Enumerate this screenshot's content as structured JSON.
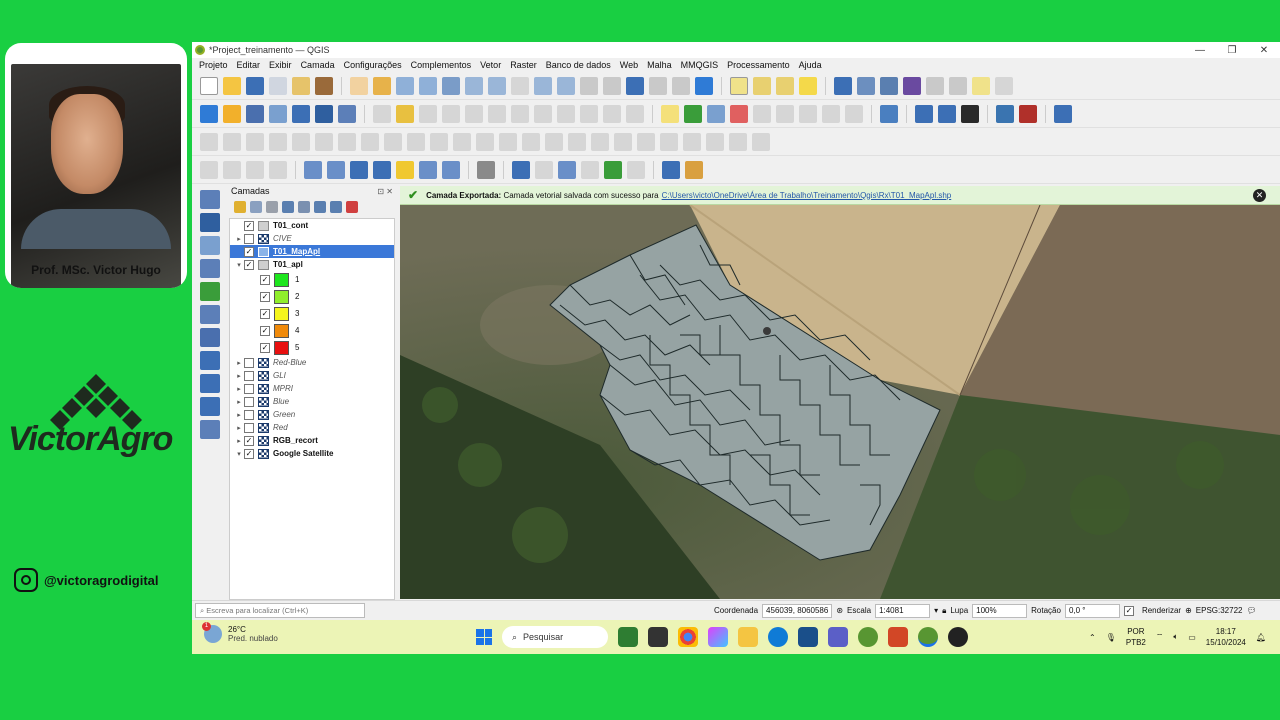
{
  "presenter": {
    "name": "Prof. MSc. Victor Hugo"
  },
  "brand": {
    "name": "VictorAgro",
    "instagram": "@victoragrodigital",
    "accent": "#19cf42"
  },
  "window": {
    "title": "*Project_treinamento — QGIS",
    "controls": {
      "minimize": "—",
      "maximize": "❐",
      "close": "✕"
    }
  },
  "menu": [
    "Projeto",
    "Editar",
    "Exibir",
    "Camada",
    "Configurações",
    "Complementos",
    "Vetor",
    "Raster",
    "Banco de dados",
    "Web",
    "Malha",
    "MMQGIS",
    "Processamento",
    "Ajuda"
  ],
  "layers_panel": {
    "title": "Camadas",
    "controls": "⊡ ✕",
    "layers": [
      {
        "name": "T01_cont",
        "checked": true,
        "expand": "",
        "style": "bold",
        "icon": "poly"
      },
      {
        "name": "CIVE",
        "checked": false,
        "expand": "▸",
        "style": "it",
        "icon": "raster"
      },
      {
        "name": "T01_MapApl",
        "checked": true,
        "expand": "",
        "style": "bold",
        "icon": "polysel",
        "selected": true
      },
      {
        "name": "T01_apl",
        "checked": true,
        "expand": "▾",
        "style": "bold",
        "icon": "poly"
      },
      {
        "name": "1",
        "checked": true,
        "class_color": "#1ee61e"
      },
      {
        "name": "2",
        "checked": true,
        "class_color": "#90ee2c"
      },
      {
        "name": "3",
        "checked": true,
        "class_color": "#f5f51c"
      },
      {
        "name": "4",
        "checked": true,
        "class_color": "#f08a0a"
      },
      {
        "name": "5",
        "checked": true,
        "class_color": "#e81010"
      },
      {
        "name": "Red-Blue",
        "checked": false,
        "expand": "▸",
        "style": "it",
        "icon": "raster"
      },
      {
        "name": "GLI",
        "checked": false,
        "expand": "▸",
        "style": "it",
        "icon": "raster"
      },
      {
        "name": "MPRI",
        "checked": false,
        "expand": "▸",
        "style": "it",
        "icon": "raster"
      },
      {
        "name": "Blue",
        "checked": false,
        "expand": "▸",
        "style": "it",
        "icon": "raster"
      },
      {
        "name": "Green",
        "checked": false,
        "expand": "▸",
        "style": "it",
        "icon": "raster"
      },
      {
        "name": "Red",
        "checked": false,
        "expand": "▸",
        "style": "it",
        "icon": "raster"
      },
      {
        "name": "RGB_recort",
        "checked": true,
        "expand": "▸",
        "style": "bold",
        "icon": "raster"
      },
      {
        "name": "Google Satellite",
        "checked": true,
        "expand": "▾",
        "style": "bold",
        "icon": "raster"
      }
    ]
  },
  "message_bar": {
    "title": "Camada Exportada:",
    "text": "Camada vetorial salvada com sucesso para",
    "path": "C:\\Users\\victo\\OneDrive\\Área de Trabalho\\Treinamento\\Qgis\\Rx\\T01_MapApl.shp"
  },
  "statusbar": {
    "locator_placeholder": "Escreva para localizar (Ctrl+K)",
    "coord_label": "Coordenada",
    "coord_value": "456039, 8060586",
    "scale_label": "Escala",
    "scale_value": "1:4081",
    "magnifier_label": "Lupa",
    "magnifier_value": "100%",
    "rotation_label": "Rotação",
    "rotation_value": "0,0 °",
    "render_label": "Renderizar",
    "crs": "EPSG:32722"
  },
  "taskbar": {
    "weather_temp": "26°C",
    "weather_desc": "Pred. nublado",
    "weather_badge": "1",
    "search_label": "Pesquisar",
    "lang_top": "POR",
    "lang_bottom": "PTB2",
    "time": "18:17",
    "date": "15/10/2024"
  }
}
